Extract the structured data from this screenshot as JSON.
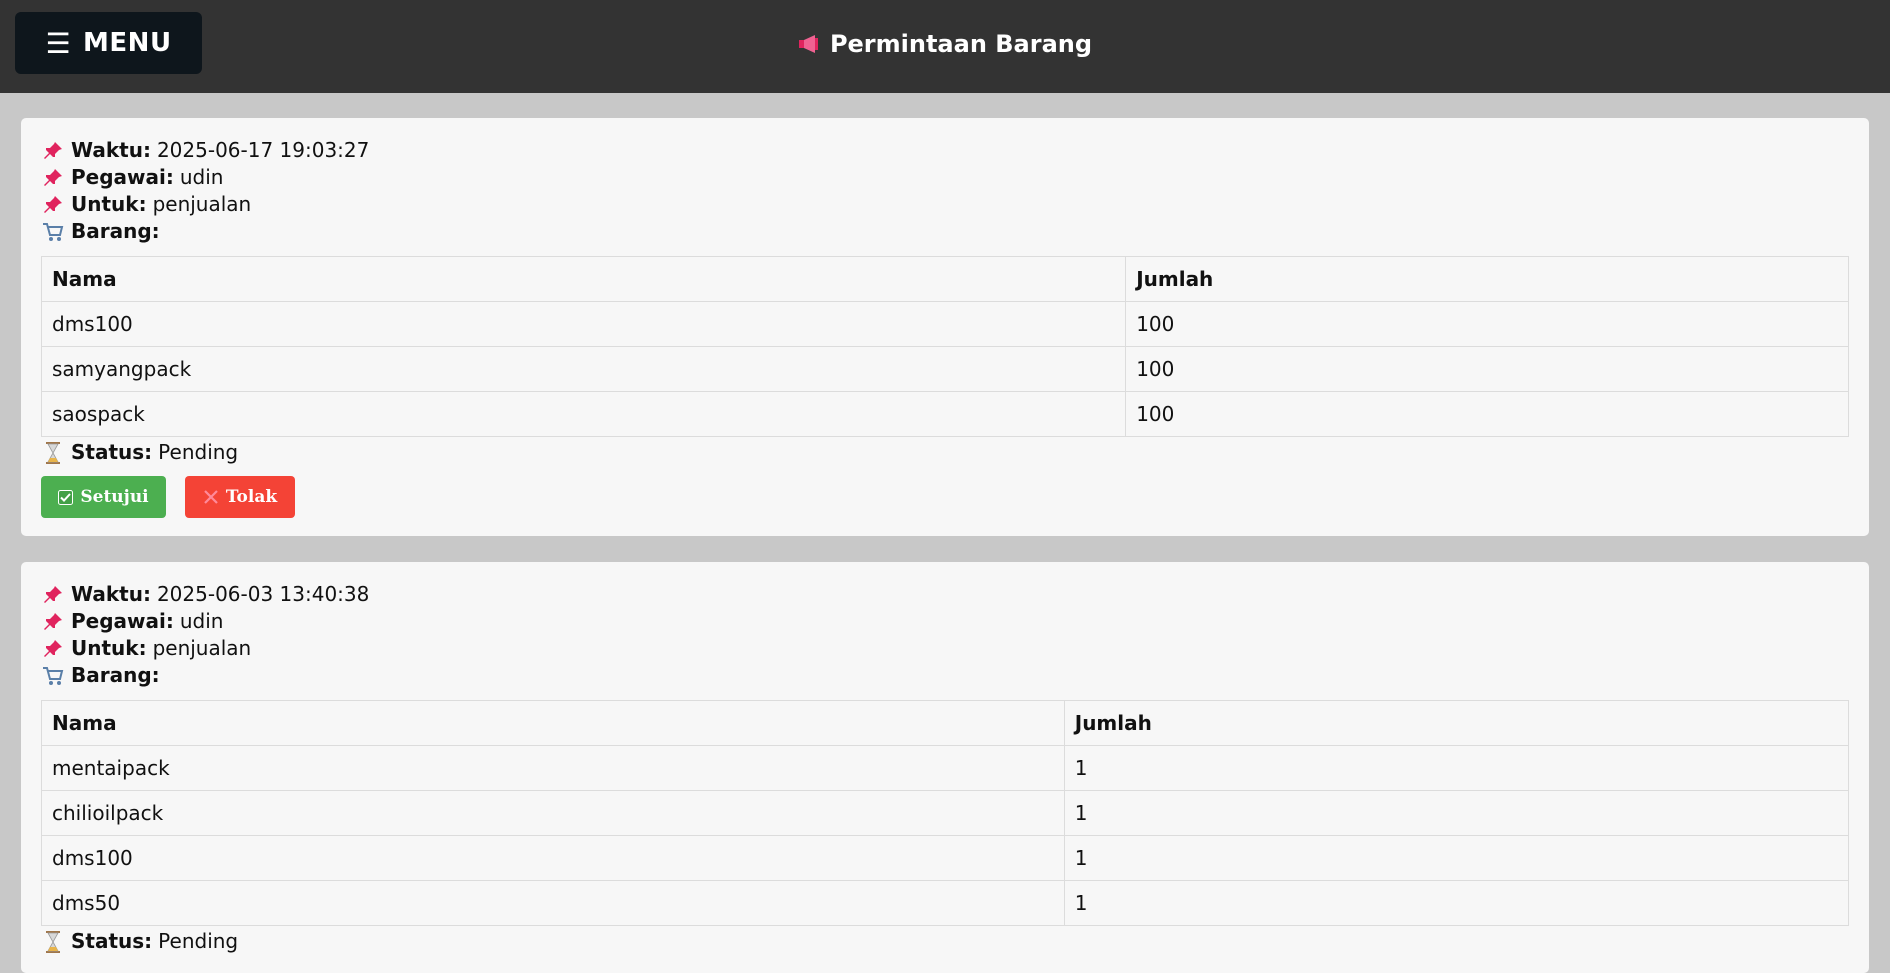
{
  "header": {
    "menu_label": "MENU",
    "title": "Permintaan Barang"
  },
  "labels": {
    "waktu": "Waktu:",
    "pegawai": "Pegawai:",
    "untuk": "Untuk:",
    "barang": "Barang:",
    "status": "Status:",
    "col_nama": "Nama",
    "col_jumlah": "Jumlah",
    "approve": "Setujui",
    "reject": "Tolak"
  },
  "colors": {
    "topbar": "#333333",
    "approve": "#4caf50",
    "reject": "#f44336",
    "pin": "#e0245e"
  },
  "requests": [
    {
      "waktu": "2025-06-17 19:03:27",
      "pegawai": "udin",
      "untuk": "penjualan",
      "status": "Pending",
      "items": [
        {
          "nama": "dms100",
          "jumlah": "100"
        },
        {
          "nama": "samyangpack",
          "jumlah": "100"
        },
        {
          "nama": "saospack",
          "jumlah": "100"
        }
      ]
    },
    {
      "waktu": "2025-06-03 13:40:38",
      "pegawai": "udin",
      "untuk": "penjualan",
      "status": "Pending",
      "items": [
        {
          "nama": "mentaipack",
          "jumlah": "1"
        },
        {
          "nama": "chilioilpack",
          "jumlah": "1"
        },
        {
          "nama": "dms100",
          "jumlah": "1"
        },
        {
          "nama": "dms50",
          "jumlah": "1"
        }
      ]
    }
  ]
}
